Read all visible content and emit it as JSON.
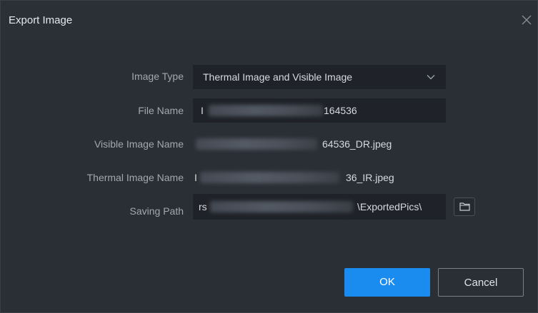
{
  "dialog": {
    "title": "Export Image",
    "close_icon": "close-icon"
  },
  "form": {
    "image_type": {
      "label": "Image Type",
      "value": "Thermal Image and Visible Image",
      "icon": "chevron-down-icon"
    },
    "file_name": {
      "label": "File Name",
      "prefix": "I",
      "suffix": "164536"
    },
    "visible_image_name": {
      "label": "Visible Image Name",
      "suffix": "64536_DR.jpeg"
    },
    "thermal_image_name": {
      "label": "Thermal Image Name",
      "prefix": "I",
      "suffix": "36_IR.jpeg"
    },
    "saving_path": {
      "label": "Saving Path",
      "prefix": "rs",
      "suffix": "\\ExportedPics\\",
      "browse_icon": "folder-icon"
    }
  },
  "buttons": {
    "ok": "OK",
    "cancel": "Cancel"
  },
  "colors": {
    "accent": "#1a8cf0",
    "dialog_bg": "#2a2e35",
    "field_bg": "#1f2228"
  }
}
